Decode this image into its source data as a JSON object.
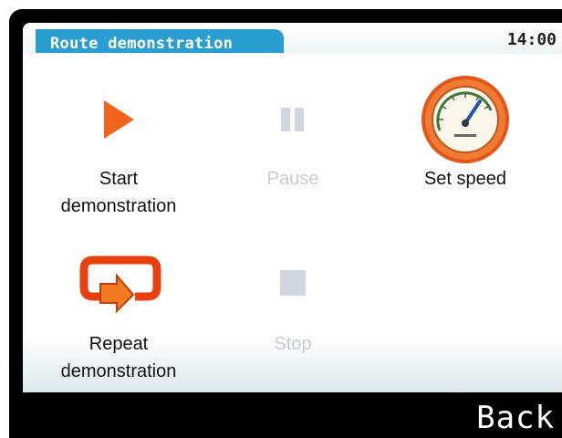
{
  "header": {
    "title": "Route demonstration",
    "time": "14:00"
  },
  "menu": {
    "items": [
      {
        "label": "Start demonstration",
        "icon": "play-icon",
        "enabled": true
      },
      {
        "label": "Pause",
        "icon": "pause-icon",
        "enabled": false
      },
      {
        "label": "Set speed",
        "icon": "speedometer-icon",
        "enabled": true
      },
      {
        "label": "Repeat demonstration",
        "icon": "repeat-icon",
        "enabled": true
      },
      {
        "label": "Stop",
        "icon": "stop-icon",
        "enabled": false
      }
    ]
  },
  "softkeys": {
    "back_label": "Back"
  },
  "colors": {
    "accent": "#2a9ed1",
    "play": "#f0641e",
    "disabled": "#c6ccd0"
  }
}
